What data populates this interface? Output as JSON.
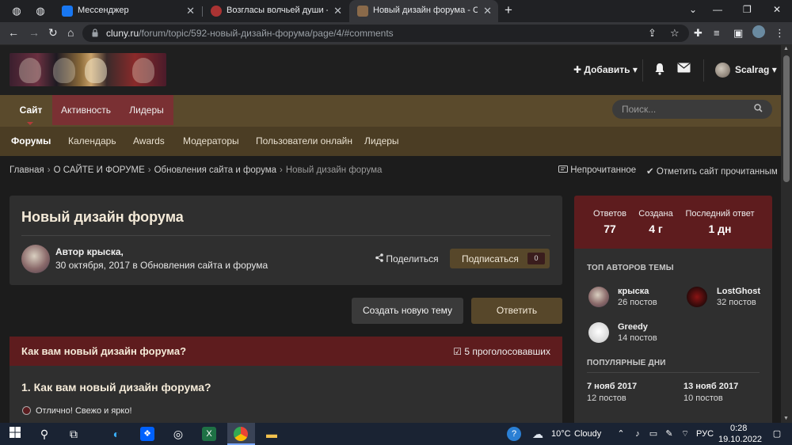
{
  "browser": {
    "tabs": [
      {
        "title": "Мессенджер",
        "close": "✕"
      },
      {
        "title": "Возгласы волчьей души - Страница",
        "close": "✕"
      },
      {
        "title": "Новый дизайн форума - Страница",
        "close": "✕"
      }
    ],
    "new_tab": "+",
    "url_host": "cluny.ru",
    "url_path": "/forum/topic/592-новый-дизайн-форума/page/4/#comments"
  },
  "header": {
    "add_label": "Добавить",
    "username": "Scalrag"
  },
  "nav": {
    "primary": [
      "Сайт",
      "Активность",
      "Лидеры"
    ],
    "secondary": [
      "Форумы",
      "Календарь",
      "Awards",
      "Модераторы",
      "Пользователи онлайн",
      "Лидеры"
    ],
    "search_placeholder": "Поиск..."
  },
  "breadcrumb": {
    "items": [
      "Главная",
      "О САЙТЕ И ФОРУМЕ",
      "Обновления сайта и форума"
    ],
    "current": "Новый дизайн форума",
    "unread": "Непрочитанное",
    "mark_read": "Отметить сайт прочитанным"
  },
  "topic": {
    "title": "Новый дизайн форума",
    "author_line": "Автор крыска,",
    "meta": "30 октября, 2017 в Обновления сайта и форума",
    "share": "Поделиться",
    "subscribe": "Подписаться",
    "subscribers": "0"
  },
  "actions": {
    "new_topic": "Создать новую тему",
    "reply": "Ответить"
  },
  "poll": {
    "title": "Как вам новый дизайн форума?",
    "voters": "5 проголосовавших",
    "question": "1. Как вам новый дизайн форума?",
    "option1": "Отлично! Свежо и ярко!"
  },
  "stats": {
    "replies_label": "Ответов",
    "replies": "77",
    "created_label": "Создана",
    "created": "4 г",
    "last_label": "Последний ответ",
    "last": "1 дн"
  },
  "sidebar": {
    "top_authors_title": "ТОП АВТОРОВ ТЕМЫ",
    "authors": [
      {
        "name": "крыска",
        "posts": "26 постов"
      },
      {
        "name": "LostGhost",
        "posts": "32 постов"
      },
      {
        "name": "Greedy",
        "posts": "14 постов"
      }
    ],
    "popular_days_title": "ПОПУЛЯРНЫЕ ДНИ",
    "days": [
      {
        "date": "7 нояб 2017",
        "posts": "12 постов"
      },
      {
        "date": "13 нояб 2017",
        "posts": "10 постов"
      }
    ]
  },
  "taskbar": {
    "temp": "10°C",
    "weather": "Cloudy",
    "lang": "РУС",
    "time": "0:28",
    "date": "19.10.2022"
  },
  "colors": {
    "nav_gold": "#5a4a2c",
    "accent_red": "#5e1c1e",
    "card": "#2f2f2f",
    "page_bg": "#1c1c1c"
  }
}
